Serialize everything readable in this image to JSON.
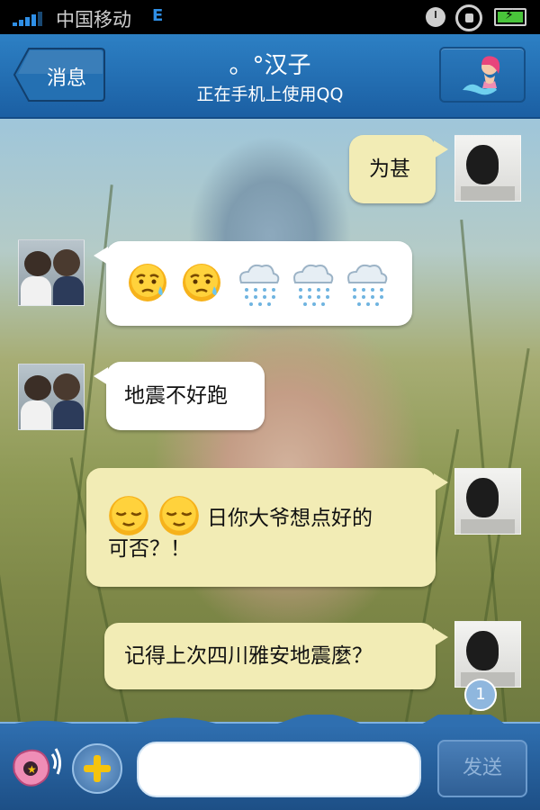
{
  "status_bar": {
    "carrier": "中国移动",
    "network_type": "E",
    "icons": [
      "signal-icon",
      "clock-icon",
      "rotate-lock-icon",
      "battery-charging-icon"
    ]
  },
  "header": {
    "back_label": "消息",
    "contact_name": "。°汉子",
    "contact_status": "正在手机上使用QQ",
    "profile_icon": "mermaid-icon"
  },
  "messages": [
    {
      "sender": "self",
      "text": "为甚"
    },
    {
      "sender": "other",
      "text": "",
      "emoji": [
        "sweat-face-icon",
        "sweat-face-icon",
        "rain-cloud-icon",
        "rain-cloud-icon",
        "rain-cloud-icon"
      ]
    },
    {
      "sender": "other",
      "text": "地震不好跑"
    },
    {
      "sender": "self",
      "text_line1": "日你大爷想点好的",
      "text_line2": "可否？！",
      "emoji": [
        "relieved-face-icon",
        "relieved-face-icon"
      ]
    },
    {
      "sender": "self",
      "text": "记得上次四川雅安地震麼？"
    }
  ],
  "unread_count": "1",
  "input_bar": {
    "placeholder": "",
    "send_label": "发送",
    "icons": [
      "shell-voice-icon",
      "plus-icon"
    ]
  },
  "colors": {
    "header_blue": "#2d80c4",
    "self_bubble": "#f2ecb5",
    "other_bubble": "#ffffff",
    "plus_yellow": "#f5c30d"
  }
}
